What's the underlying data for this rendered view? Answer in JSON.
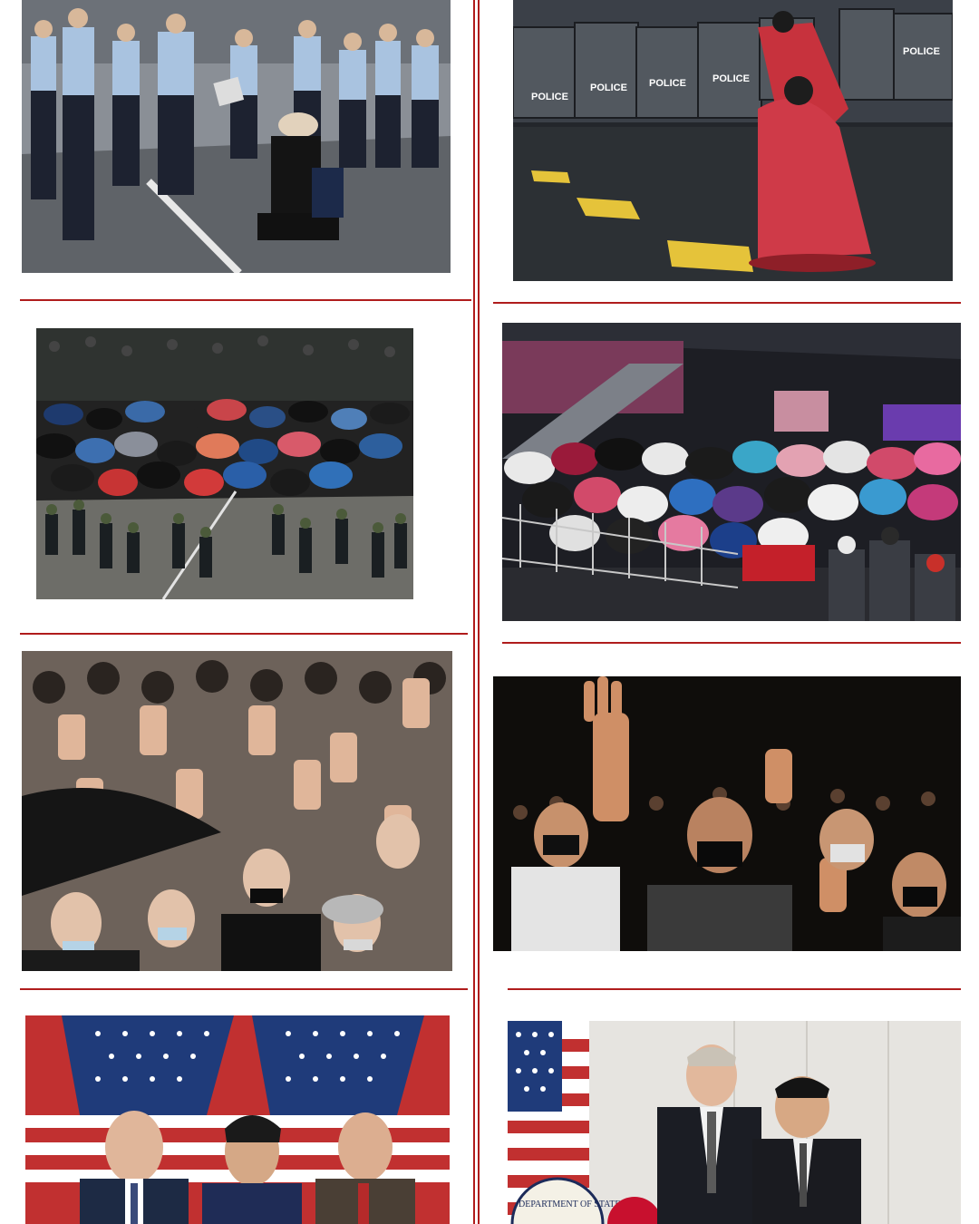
{
  "collage": {
    "panels": [
      {
        "id": "p1",
        "scene": "hong-kong-kneeling-protester"
      },
      {
        "id": "p2",
        "scene": "thailand-kneeling-protester-riot-police"
      },
      {
        "id": "p3",
        "scene": "hong-kong-umbrella-crowd"
      },
      {
        "id": "p4",
        "scene": "thailand-umbrella-barricade"
      },
      {
        "id": "p5",
        "scene": "hong-kong-raised-hands"
      },
      {
        "id": "p6",
        "scene": "thailand-three-finger-salute"
      },
      {
        "id": "p7",
        "scene": "us-flags-press-conference"
      },
      {
        "id": "p8",
        "scene": "us-embassy-meeting"
      }
    ],
    "colors": {
      "divider": "#b01c1c",
      "background": "#ffffff"
    }
  },
  "signage": {
    "police_shield": "POLICE",
    "seal_text": "DEPARTMENT OF STATE"
  }
}
